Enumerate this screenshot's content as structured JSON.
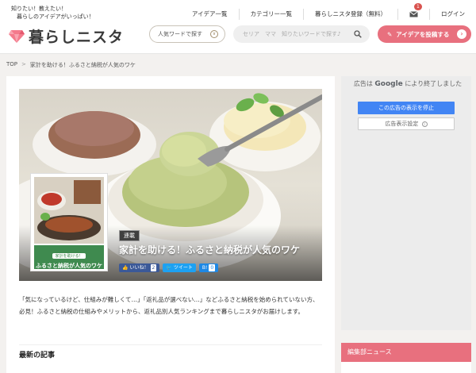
{
  "header": {
    "tagline": "知りたい！教えたい！\n　暮らしのアイデアがいっぱい！",
    "logo_text": "暮らしニスタ",
    "nav": {
      "ideas": "アイデア一覧",
      "categories": "カテゴリー一覧",
      "register": "暮らしニスタ登録（無料）",
      "mail_badge": "1",
      "login": "ログイン"
    },
    "category_button": "人気ワードで探す",
    "search_placeholder": "セリア　ママ　知りたいワードで探す♪",
    "post_button": "アイデアを投稿する"
  },
  "breadcrumb": {
    "home": "TOP",
    "separator": ">",
    "current": "家計を助ける！ふるさと納税が人気のワケ"
  },
  "article": {
    "category_tag": "連載",
    "title": "家計を助ける！ふるさと納税が人気のワケ",
    "thumb_label_small": "家計を助ける！",
    "thumb_label_main": "ふるさと納税が人気のワケ",
    "social": {
      "like_label": "いいね！",
      "like_count": "2",
      "tweet_label": "ツイート",
      "hatena_label": "B!",
      "hatena_count": "0"
    },
    "intro": "「気になっているけど、仕組みが難しくて…」「返礼品が選べない…」などふるさと納税を始められていない方、必見！ふるさと納税の仕組みやメリットから、返礼品別人気ランキングまで暮らしニスタがお届けします。",
    "latest_heading": "最新の記事"
  },
  "sidebar": {
    "ad_text_before": "広告は",
    "ad_text_google": "Google",
    "ad_text_after": "により終了しました",
    "ad_stop_button": "この広告の表示を停止",
    "ad_settings_button": "広告表示設定",
    "news_heading": "編集部ニュース"
  },
  "colors": {
    "accent_pink": "#e8707e",
    "facebook": "#3b5998",
    "twitter": "#1da1f2",
    "google_blue": "#4285f4"
  }
}
